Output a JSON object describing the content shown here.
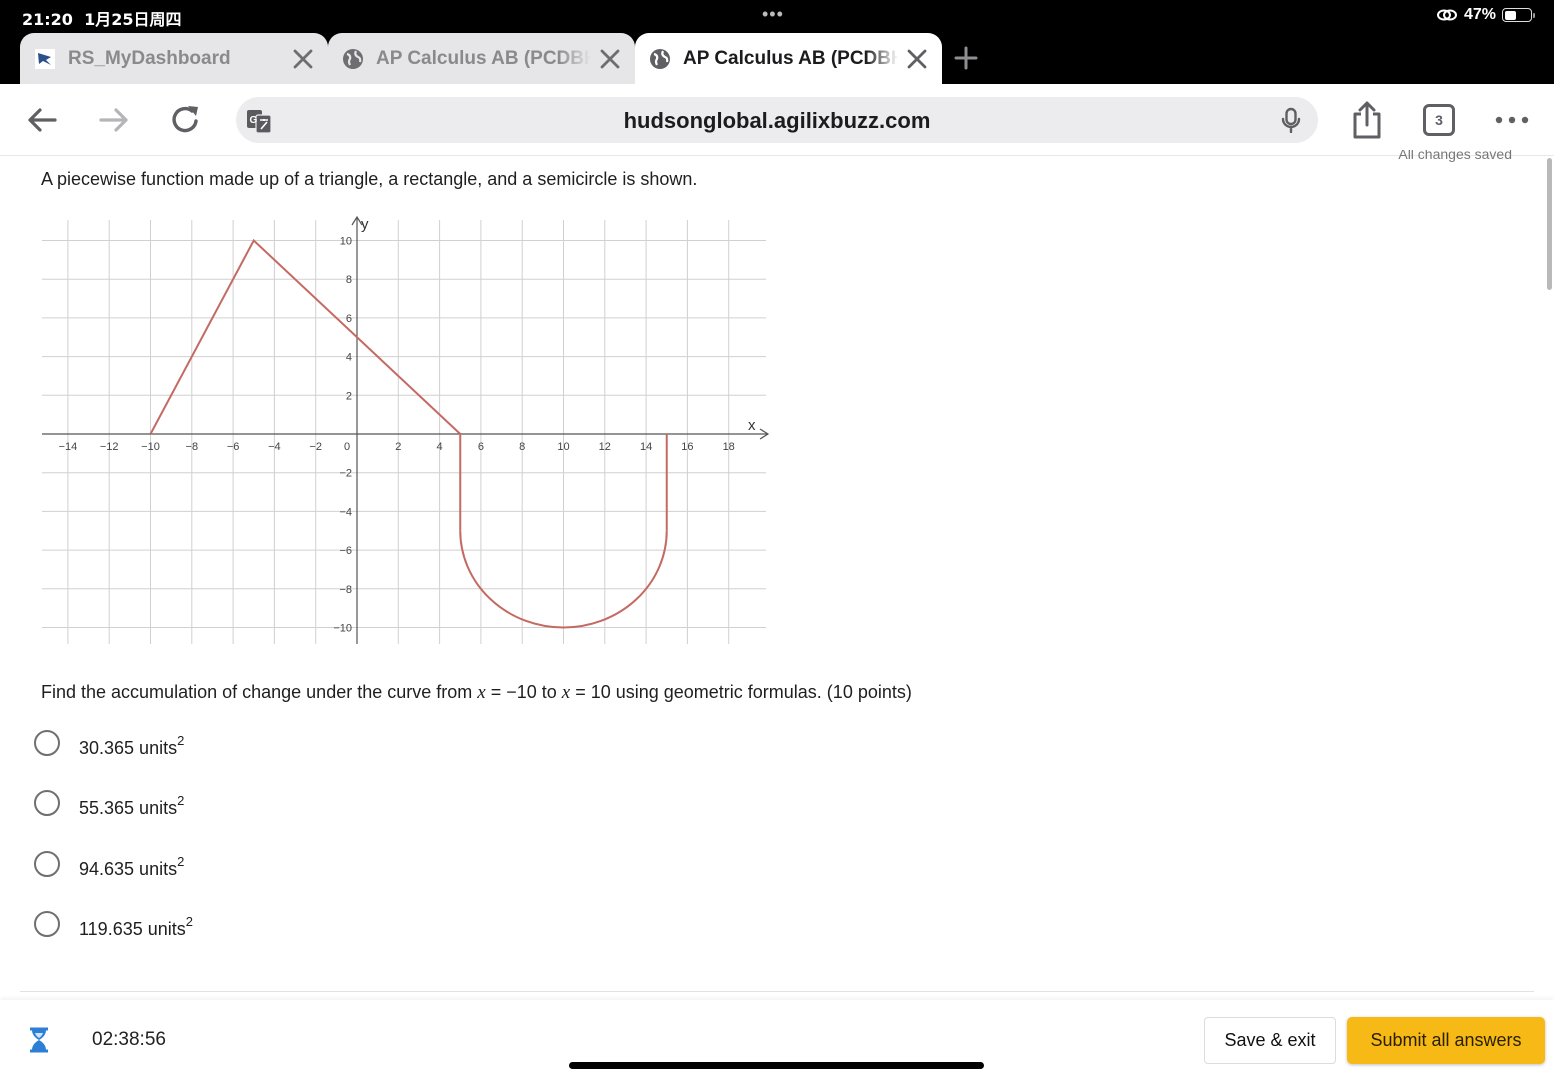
{
  "status_bar": {
    "time": "21:20",
    "date": "1月25日周四",
    "dots": "•••",
    "battery_percent": "47%",
    "battery_level": 0.47
  },
  "tabs": [
    {
      "title": "RS_MyDashboard",
      "icon": "dashboard-favicon",
      "active": false
    },
    {
      "title": "AP Calculus AB (PCDBH",
      "icon": "globe-icon",
      "active": false
    },
    {
      "title": "AP Calculus AB (PCDBH",
      "icon": "globe-icon",
      "active": true
    }
  ],
  "toolbar": {
    "url": "hudsonglobal.agilixbuzz.com",
    "tab_count": "3"
  },
  "page": {
    "saved_status": "All changes saved",
    "prompt": "A piecewise function made up of a triangle, a rectangle, and a semicircle is shown.",
    "question_parts": {
      "pre": "Find the accumulation of change under the curve from ",
      "var1": "x",
      "mid1": " = −10 to ",
      "var2": "x",
      "post": " = 10 using geometric formulas. (10 points)"
    },
    "options": [
      {
        "value": "30.365 units",
        "sup": "2",
        "selected": false
      },
      {
        "value": "55.365 units",
        "sup": "2",
        "selected": false
      },
      {
        "value": "94.635 units",
        "sup": "2",
        "selected": false
      },
      {
        "value": "119.635 units",
        "sup": "2",
        "selected": false
      }
    ]
  },
  "footer": {
    "timer": "02:38:56",
    "save_label": "Save & exit",
    "submit_label": "Submit all answers",
    "accent": "#f7b916",
    "timer_icon_color": "#2d7fd6"
  },
  "chart_data": {
    "type": "line",
    "title": "",
    "xlabel": "x",
    "ylabel": "y",
    "xlim": [
      -15,
      19.5
    ],
    "ylim": [
      -11,
      11
    ],
    "grid": true,
    "x_ticks": [
      -14,
      -12,
      -10,
      -8,
      -6,
      -4,
      -2,
      0,
      2,
      4,
      6,
      8,
      10,
      12,
      14,
      16,
      18
    ],
    "y_ticks": [
      -10,
      -8,
      -6,
      -4,
      -2,
      2,
      4,
      6,
      8,
      10
    ],
    "curve_color": "#c46a63",
    "segments": [
      {
        "kind": "line",
        "points": [
          [
            -10,
            0
          ],
          [
            -5,
            10
          ],
          [
            5,
            0
          ]
        ]
      },
      {
        "kind": "line",
        "points": [
          [
            5,
            0
          ],
          [
            5,
            -5
          ]
        ]
      },
      {
        "kind": "semicircle",
        "center": [
          10,
          -5
        ],
        "radius": 5,
        "from_x": 5,
        "to_x": 15,
        "side": "below"
      },
      {
        "kind": "line",
        "points": [
          [
            15,
            -5
          ],
          [
            15,
            0
          ]
        ]
      }
    ]
  }
}
